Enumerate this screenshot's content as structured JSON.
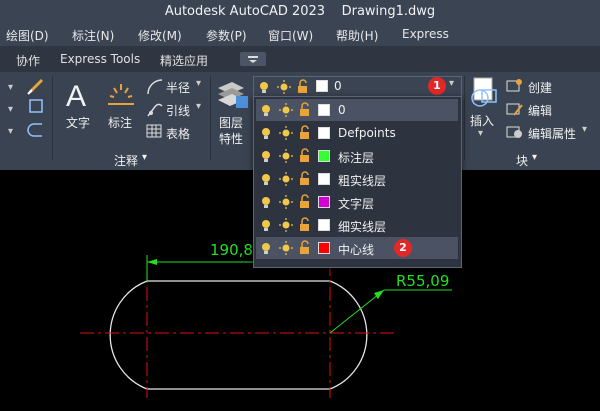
{
  "app": {
    "title": "Autodesk AutoCAD 2023    Drawing1.dwg"
  },
  "menu": [
    "绘图(D)",
    "标注(N)",
    "修改(M)",
    "参数(P)",
    "窗口(W)",
    "帮助(H)",
    "Express"
  ],
  "tabs": [
    "协作",
    "Express Tools",
    "精选应用"
  ],
  "ribbon": {
    "annotation": {
      "text_label": "文字",
      "dim_label": "标注",
      "radius_label": "半径",
      "leader_label": "引线",
      "table_label": "表格",
      "panel_title": "注释"
    },
    "layer_props": {
      "line1": "图层",
      "line2": "特性"
    },
    "block": {
      "insert_label": "插入",
      "create_label": "创建",
      "edit_label": "编辑",
      "edit_attr_label": "编辑属性",
      "panel_title": "块"
    }
  },
  "layer_combo": {
    "current": "0",
    "badge": "1"
  },
  "layers": [
    {
      "name": "0",
      "color": "#ffffff"
    },
    {
      "name": "Defpoints",
      "color": "#ffffff"
    },
    {
      "name": "标注层",
      "color": "#33ff33"
    },
    {
      "name": "粗实线层",
      "color": "#ffffff"
    },
    {
      "name": "文字层",
      "color": "#d400d4"
    },
    {
      "name": "细实线层",
      "color": "#ffffff"
    },
    {
      "name": "中心线",
      "color": "#ff0000",
      "badge": "2"
    }
  ],
  "drawing": {
    "dim_linear": "190,8",
    "dim_radius": "R55,09"
  },
  "colors": {
    "dimension": "#22e022",
    "centerline": "#e01010",
    "outline": "#e6e6e6"
  }
}
